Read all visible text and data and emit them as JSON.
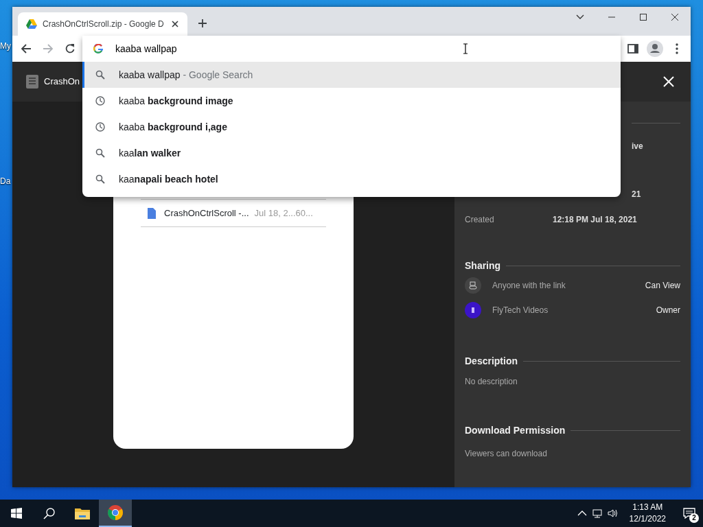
{
  "desktop": {
    "icons": [
      {
        "label": "My"
      },
      {
        "label": "Da"
      }
    ]
  },
  "browser": {
    "tabs": [
      {
        "title": "CrashOnCtrlScroll.zip - Google D",
        "selected": true
      }
    ],
    "nav": {
      "back_disabled": false,
      "forward_disabled": true
    }
  },
  "omnibox": {
    "value": "kaaba wallpap",
    "suggestions": [
      {
        "kind": "search",
        "text": "kaaba wallpap",
        "suffix": "- Google Search",
        "selected": true
      },
      {
        "kind": "history",
        "text": "kaaba **background image**",
        "selected": false
      },
      {
        "kind": "history",
        "text": "kaaba **background i,age**",
        "selected": false
      },
      {
        "kind": "search",
        "text": "kaa**lan walker**",
        "selected": false
      },
      {
        "kind": "search",
        "text": "kaa**napali beach hotel**",
        "selected": false
      }
    ]
  },
  "viewer": {
    "file_name": "CrashOn",
    "file_row": {
      "name": "CrashOnCtrlScroll -...",
      "meta": "Jul 18, 2...60..."
    }
  },
  "details": {
    "fragments": [
      "ive",
      "21"
    ],
    "created": {
      "label": "Created",
      "value": "12:18 PM Jul 18, 2021"
    },
    "sharing": {
      "title": "Sharing",
      "entries": [
        {
          "kind": "link",
          "name": "Anyone with the link",
          "role": "Can View"
        },
        {
          "kind": "user",
          "name": "FlyTech Videos",
          "role": "Owner"
        }
      ]
    },
    "description": {
      "title": "Description",
      "text": "No description"
    },
    "download": {
      "title": "Download Permission",
      "text": "Viewers can download"
    }
  },
  "taskbar": {
    "apps": [
      {
        "kind": "explorer",
        "active": false
      },
      {
        "kind": "chrome",
        "active": true
      }
    ],
    "clock": {
      "time": "1:13 AM",
      "date": "12/1/2022"
    },
    "notifications": "2"
  }
}
